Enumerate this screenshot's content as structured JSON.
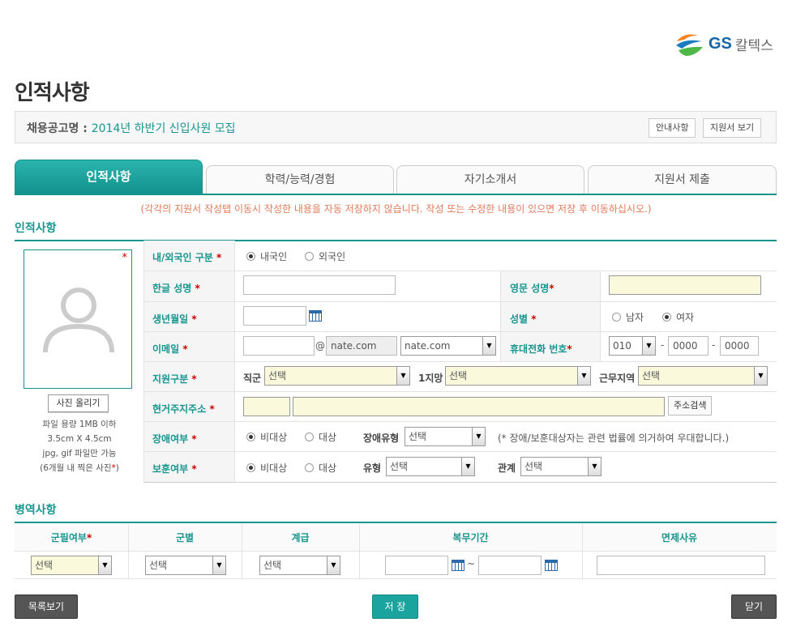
{
  "logo": {
    "gs": "GS",
    "kr": "칼텍스"
  },
  "page_title": "인적사항",
  "notice": {
    "label": "채용공고명 : ",
    "value": "2014년 하반기 신입사원 모집",
    "guide_btn": "안내사항",
    "view_btn": "지원서 보기"
  },
  "tabs": [
    "인적사항",
    "학력/능력/경험",
    "자기소개서",
    "지원서 제출"
  ],
  "warning": "(각각의 지원서 작성탭 이동시 작성한 내용을 자동 저장하지 않습니다. 작성 또는 수정한 내용이 있으면 저장 후 이동하십시오.)",
  "section1_title": "인적사항",
  "photo": {
    "star": "*",
    "upload_btn": "사진 올리기",
    "notes": [
      "파일 용량 1MB 이하",
      "3.5cm X 4.5cm",
      "jpg, gif 파일만 가능",
      "(6개월 내 찍은 사진"
    ],
    "notes_star": "*",
    "notes_close": ")"
  },
  "star": "*",
  "form": {
    "nationality": {
      "label": "내/외국인 구분",
      "opt1": "내국인",
      "opt2": "외국인",
      "selected": "내국인"
    },
    "name_kr": {
      "label": "한글 성명",
      "value": ""
    },
    "name_en": {
      "label": "영문 성명",
      "value": ""
    },
    "birth": {
      "label": "생년월일",
      "value": ""
    },
    "gender": {
      "label": "성별",
      "opt1": "남자",
      "opt2": "여자",
      "selected": "여자"
    },
    "email": {
      "label": "이메일",
      "id": "",
      "at": "@",
      "domain": "nate.com",
      "domain_select": "nate.com"
    },
    "phone": {
      "label": "휴대전화 번호",
      "p1": "010",
      "dash": "-",
      "p2": "0000",
      "p3": "0000"
    },
    "apply_type": {
      "label": "지원구분",
      "job_label": "직군",
      "job_value": "선택",
      "pref_label": "1지망",
      "pref_value": "선택",
      "region_label": "근무지역",
      "region_value": "선택"
    },
    "address": {
      "label": "현거주지주소",
      "zip": "",
      "addr": "",
      "search_btn": "주소검색"
    },
    "disability": {
      "label": "장애여부",
      "opt1": "비대상",
      "opt2": "대상",
      "selected": "비대상",
      "type_label": "장애유형",
      "type_value": "선택",
      "note": "(* 장애/보훈대상자는 관련 법률에 의거하여 우대합니다.)"
    },
    "veteran": {
      "label": "보훈여부",
      "opt1": "비대상",
      "opt2": "대상",
      "selected": "비대상",
      "type_label": "유형",
      "type_value": "선택",
      "rel_label": "관계",
      "rel_value": "선택"
    }
  },
  "section2_title": "병역사항",
  "military": {
    "headers": [
      "군필여부",
      "군별",
      "계급",
      "복무기간",
      "면제사유"
    ],
    "status_value": "선택",
    "branch_value": "선택",
    "rank_value": "선택",
    "period_from": "",
    "tilde": "~",
    "period_to": "",
    "exempt_reason": ""
  },
  "buttons": {
    "list": "목록보기",
    "save": "저 장",
    "close": "닫기"
  }
}
